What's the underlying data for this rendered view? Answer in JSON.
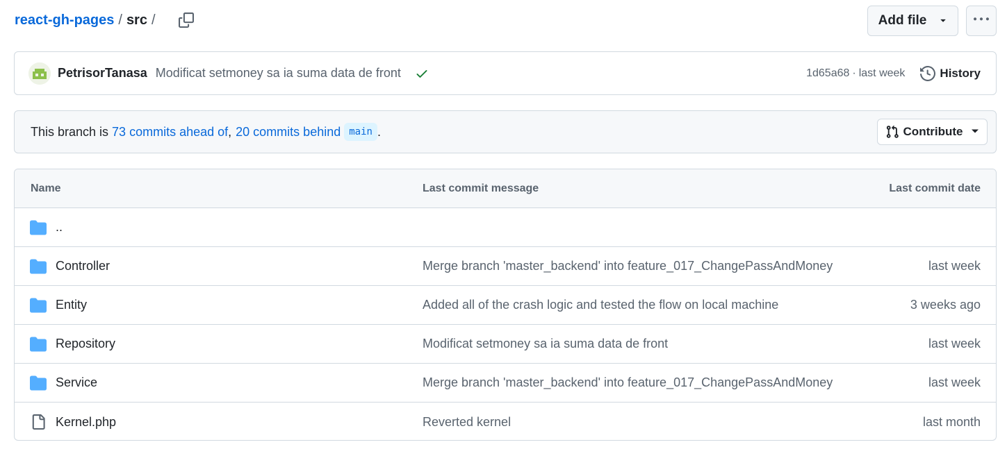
{
  "breadcrumb": {
    "repo": "react-gh-pages",
    "sep1": "/",
    "dir": "src",
    "sep2": "/"
  },
  "actions": {
    "add_file_label": "Add file"
  },
  "latest_commit": {
    "author": "PetrisorTanasa",
    "message": "Modificat setmoney sa ia suma data de front",
    "sha": "1d65a68",
    "dot": "·",
    "time": "last week",
    "history_label": "History",
    "status_color": "#1a7f37"
  },
  "branch_info": {
    "prefix": "This branch is ",
    "ahead": "73 commits ahead of",
    "comma": ",",
    "behind": "20 commits behind",
    "base": "main",
    "suffix": ".",
    "contribute_label": "Contribute"
  },
  "table": {
    "headers": {
      "name": "Name",
      "message": "Last commit message",
      "date": "Last commit date"
    },
    "rows": [
      {
        "icon": "folder-icon",
        "name": "..",
        "message": "",
        "date": ""
      },
      {
        "icon": "folder-icon",
        "name": "Controller",
        "message": "Merge branch 'master_backend' into feature_017_ChangePassAndMoney",
        "date": "last week"
      },
      {
        "icon": "folder-icon",
        "name": "Entity",
        "message": "Added all of the crash logic and tested the flow on local machine",
        "date": "3 weeks ago"
      },
      {
        "icon": "folder-icon",
        "name": "Repository",
        "message": "Modificat setmoney sa ia suma data de front",
        "date": "last week"
      },
      {
        "icon": "folder-icon",
        "name": "Service",
        "message": "Merge branch 'master_backend' into feature_017_ChangePassAndMoney",
        "date": "last week"
      },
      {
        "icon": "file-icon",
        "name": "Kernel.php",
        "message": "Reverted kernel",
        "date": "last month"
      }
    ]
  },
  "colors": {
    "link": "#0969da",
    "folder": "#54aeff",
    "muted": "#59636e",
    "border": "#d1d9e0"
  }
}
